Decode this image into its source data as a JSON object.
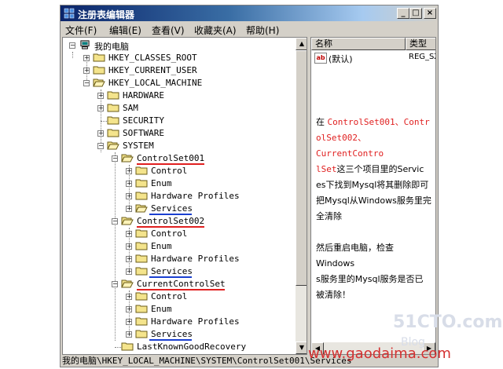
{
  "window": {
    "title": "注册表编辑器"
  },
  "menu": [
    "文件(F)",
    "编辑(E)",
    "查看(V)",
    "收藏夹(A)",
    "帮助(H)"
  ],
  "title_buttons": {
    "minimize": "_",
    "maximize": "□",
    "close": "×"
  },
  "tree": {
    "root": "我的电脑",
    "hkcr": "HKEY_CLASSES_ROOT",
    "hkcu": "HKEY_CURRENT_USER",
    "hklm": "HKEY_LOCAL_MACHINE",
    "hardware": "HARDWARE",
    "sam": "SAM",
    "security": "SECURITY",
    "software": "SOFTWARE",
    "system": "SYSTEM",
    "cs001": "ControlSet001",
    "cs002": "ControlSet002",
    "ccs": "CurrentControlSet",
    "control": "Control",
    "enum": "Enum",
    "hwprofiles": "Hardware Profiles",
    "services": "Services",
    "lkgr": "LastKnownGoodRecovery"
  },
  "list": {
    "col_name": "名称",
    "col_type": "类型",
    "row_name": "(默认)",
    "row_type": "REG_SZ",
    "row_icon": "ab"
  },
  "annotation": {
    "l1_a": "在 ",
    "l1_b": "ControlSet001、Contr",
    "l2": "olSet002、CurrentContro",
    "l3_a": "lSet",
    "l3_b": "这三个项目里的Servic",
    "l4": "es下找到Mysql将其删除即可",
    "l5": "把Mysql从Windows服务里完",
    "l6": "全清除",
    "l7": "然后重启电脑，检查Windows",
    "l8": "s服务里的Mysql服务是否已",
    "l9": "被清除！"
  },
  "status": "我的电脑\\HKEY_LOCAL_MACHINE\\SYSTEM\\ControlSet001\\Services",
  "watermarks": {
    "site1": "51CTO.com",
    "site2": "www.gaodaima.com",
    "site3": "Blog"
  },
  "colors": {
    "title_start": "#0a246a",
    "highlight_red": "#e02020",
    "underline_blue": "#1a3fd0",
    "watermark_red": "#d43030"
  }
}
